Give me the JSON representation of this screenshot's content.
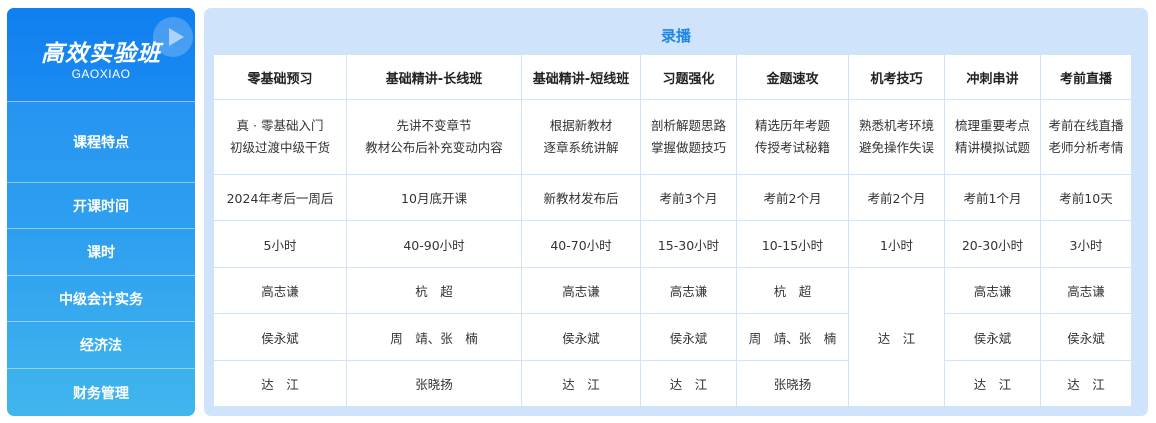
{
  "brand": {
    "title": "高效实验班",
    "subtitle": "GAOXIAO"
  },
  "row_labels": [
    "课程特点",
    "开课时间",
    "课时",
    "中级会计实务",
    "经济法",
    "财务管理"
  ],
  "section_title": "录播",
  "columns": [
    {
      "name": "零基础预习",
      "features": [
        "真 · 零基础入门",
        "初级过渡中级干货"
      ],
      "start": "2024年考后一周后",
      "hours": "5小时",
      "accounting": "高志谦",
      "law": "侯永斌",
      "finance": "达　江"
    },
    {
      "name": "基础精讲-长线班",
      "features": [
        "先讲不变章节",
        "教材公布后补充变动内容"
      ],
      "start": "10月底开课",
      "hours": "40-90小时",
      "accounting": "杭　超",
      "law": "周　靖、张　楠",
      "finance": "张晓扬"
    },
    {
      "name": "基础精讲-短线班",
      "features": [
        "根据新教材",
        "逐章系统讲解"
      ],
      "start": "新教材发布后",
      "hours": "40-70小时",
      "accounting": "高志谦",
      "law": "侯永斌",
      "finance": "达　江"
    },
    {
      "name": "习题强化",
      "features": [
        "剖析解题思路",
        "掌握做题技巧"
      ],
      "start": "考前3个月",
      "hours": "15-30小时",
      "accounting": "高志谦",
      "law": "侯永斌",
      "finance": "达　江"
    },
    {
      "name": "金题速攻",
      "features": [
        "精选历年考题",
        "传授考试秘籍"
      ],
      "start": "考前2个月",
      "hours": "10-15小时",
      "accounting": "杭　超",
      "law": "周　靖、张　楠",
      "finance": "张晓扬"
    },
    {
      "name": "机考技巧",
      "features": [
        "熟悉机考环境",
        "避免操作失误"
      ],
      "start": "考前2个月",
      "hours": "1小时",
      "teacher_all": "达　江"
    },
    {
      "name": "冲刺串讲",
      "features": [
        "梳理重要考点",
        "精讲模拟试题"
      ],
      "start": "考前1个月",
      "hours": "20-30小时",
      "accounting": "高志谦",
      "law": "侯永斌",
      "finance": "达　江"
    },
    {
      "name": "考前直播",
      "features": [
        "考前在线直播",
        "老师分析考情"
      ],
      "start": "考前10天",
      "hours": "3小时",
      "accounting": "高志谦",
      "law": "侯永斌",
      "finance": "达　江"
    }
  ]
}
